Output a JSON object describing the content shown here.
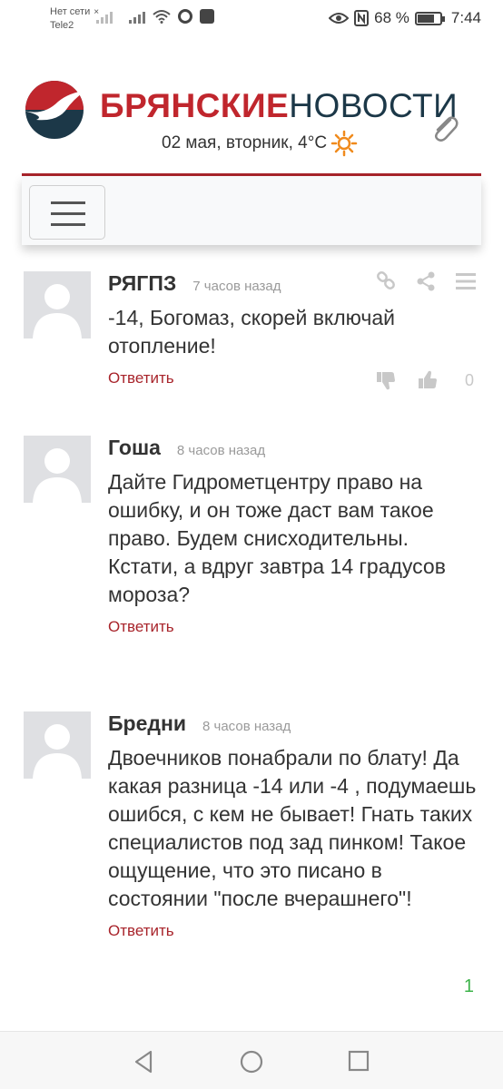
{
  "statusbar": {
    "carrier_line1": "Нет сети",
    "carrier_x": "×",
    "carrier_line2": "Tele2",
    "battery_percent": "68 %",
    "battery_level": 0.68,
    "time": "7:44"
  },
  "header": {
    "brand_part1": "БРЯНСКИЕ",
    "brand_part2": "НОВОСТИ",
    "date_weather": "02 мая, вторник, 4°C"
  },
  "comments": [
    {
      "author": "РЯГПЗ",
      "time": "7 часов назад",
      "text": "-14, Богомаз, скорей включай отопление!",
      "reply_label": "Ответить",
      "score": "0"
    },
    {
      "author": "Гоша",
      "time": "8 часов назад",
      "text": "Дайте Гидрометцентру право на ошибку, и он тоже даст вам такое право. Будем снисходительны. Кстати, а вдруг завтра 14 градусов мороза?",
      "reply_label": "Ответить"
    },
    {
      "author": "Бредни",
      "time": "8 часов назад",
      "text": "Двоечников понабрали по блату! Да какая разница -14 или -4 , подумаешь ошибся, с кем не бывает! Гнать таких специалистов под зад пинком! Такое ощущение, что это писано в состоянии \"после вчерашнего\"!",
      "reply_label": "Ответить",
      "score": "1"
    }
  ],
  "colors": {
    "brand_red": "#c0262d",
    "brand_dark": "#1c3848",
    "reply_red": "#a8242b",
    "positive_green": "#3db34a"
  },
  "icons": [
    "eye-icon",
    "nfc-icon",
    "battery-icon",
    "link-icon",
    "share-icon",
    "menu-icon",
    "thumbs-down-icon",
    "thumbs-up-icon",
    "paperclip-icon",
    "sun-icon",
    "back-icon",
    "home-icon",
    "recents-icon"
  ]
}
